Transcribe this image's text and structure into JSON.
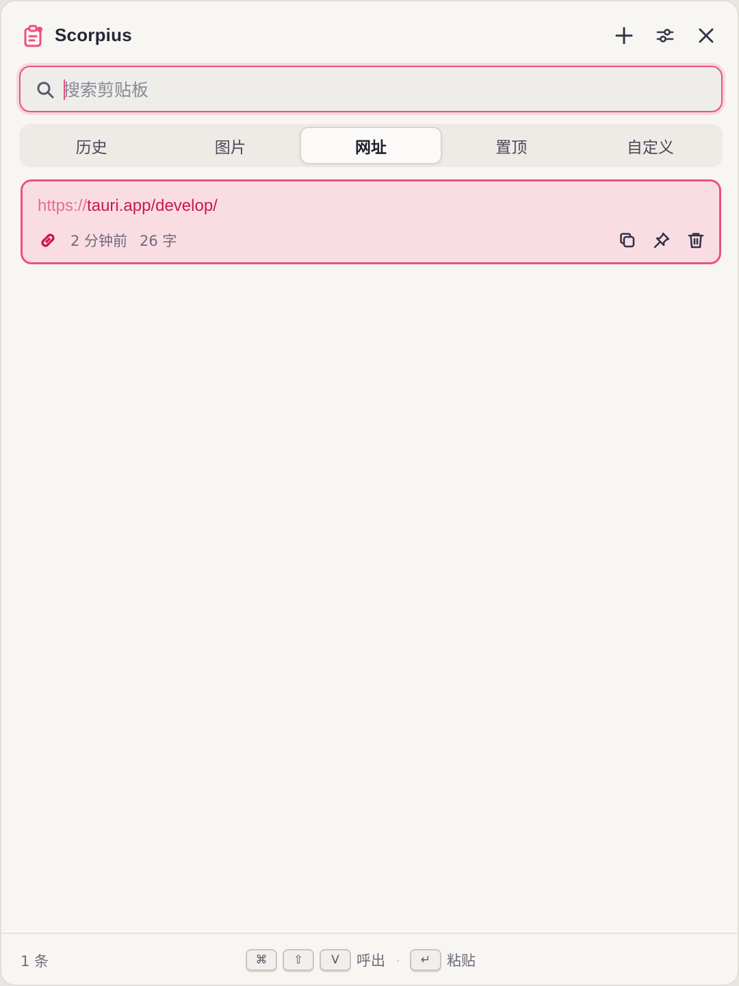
{
  "app": {
    "title": "Scorpius"
  },
  "search": {
    "placeholder": "搜索剪贴板",
    "value": ""
  },
  "tabs": [
    {
      "label": "历史",
      "active": false
    },
    {
      "label": "图片",
      "active": false
    },
    {
      "label": "网址",
      "active": true
    },
    {
      "label": "置顶",
      "active": false
    },
    {
      "label": "自定义",
      "active": false
    }
  ],
  "items": [
    {
      "url_protocol": "https://",
      "url_rest": "tauri.app/develop/",
      "time": "2 分钟前",
      "length": "26 字",
      "type_icon": "link-icon"
    }
  ],
  "footer": {
    "count": "1 条",
    "key_cmd": "⌘",
    "key_shift": "⇧",
    "key_v": "V",
    "summon_label": "呼出",
    "separator": "·",
    "key_enter": "↵",
    "paste_label": "粘贴"
  },
  "colors": {
    "accent": "#e8527f",
    "item_bg": "#fadde3",
    "link": "#c8184f",
    "window_bg": "#f8f6f2"
  }
}
